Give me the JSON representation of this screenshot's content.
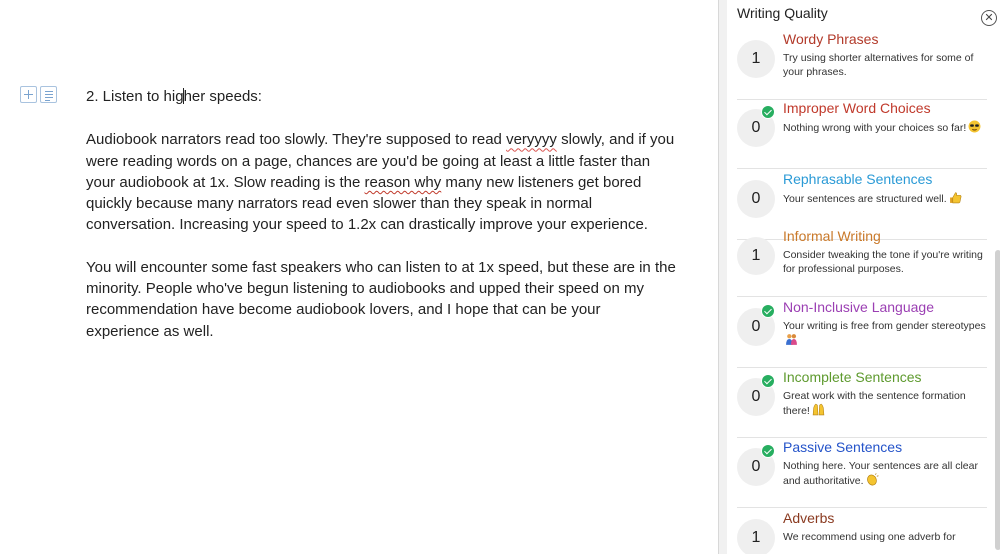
{
  "document": {
    "heading": "2. Listen to higher speeds:",
    "paragraph1": {
      "t1": "Audiobook narrators read too slowly. They're supposed to read ",
      "flag1": "veryyyy",
      "t2": " slowly, and if you were reading words on a page, chances are you'd be going at least a little faster than your audiobook at 1x. Slow reading is the ",
      "flag2": "reason why",
      "t3": " many new listeners get bored quickly because many narrators read even slower than they speak in normal conversation. Increasing your speed to 1.2x can drastically improve your experience."
    },
    "paragraph2": "You will encounter some fast speakers who can listen to at 1x speed, but these are in the minority. People who've begun listening to audiobooks and upped their speed on my recommendation have become audiobook lovers, and I hope that can be your experience as well."
  },
  "sidebar": {
    "title": "Writing Quality",
    "close_icon": "close-circle-icon",
    "cards": [
      {
        "count": "1",
        "title": "Wordy Phrases",
        "color": "#b23a2a",
        "desc": "Try using shorter alternatives for some of your phrases.",
        "check": false,
        "emoji": null
      },
      {
        "count": "0",
        "title": "Improper Word Choices",
        "color": "#c0392b",
        "desc": "Nothing wrong with your choices so far!",
        "check": true,
        "emoji": "sunglasses-emoji"
      },
      {
        "count": "0",
        "title": "Rephrasable Sentences",
        "color": "#2a9ad6",
        "desc": "Your sentences are structured well.",
        "check": false,
        "emoji": "thumbs-up-emoji"
      },
      {
        "count": "1",
        "title": "Informal Writing",
        "color": "#c9792a",
        "desc": "Consider tweaking the tone if you're writing for professional purposes.",
        "check": false,
        "emoji": null
      },
      {
        "count": "0",
        "title": "Non-Inclusive Language",
        "color": "#9b3fb3",
        "desc": "Your writing is free from gender stereotypes",
        "check": true,
        "emoji": "people-emoji"
      },
      {
        "count": "0",
        "title": "Incomplete Sentences",
        "color": "#5e9a2e",
        "desc": "Great work with the sentence formation there!",
        "check": true,
        "emoji": "raised-hands-emoji"
      },
      {
        "count": "0",
        "title": "Passive Sentences",
        "color": "#2453c9",
        "desc": "Nothing here. Your sentences are all clear and authoritative.",
        "check": true,
        "emoji": "clapping-hands-emoji"
      },
      {
        "count": "1",
        "title": "Adverbs",
        "color": "#8a3a20",
        "desc": "We recommend using one adverb for",
        "check": false,
        "emoji": null
      }
    ]
  }
}
